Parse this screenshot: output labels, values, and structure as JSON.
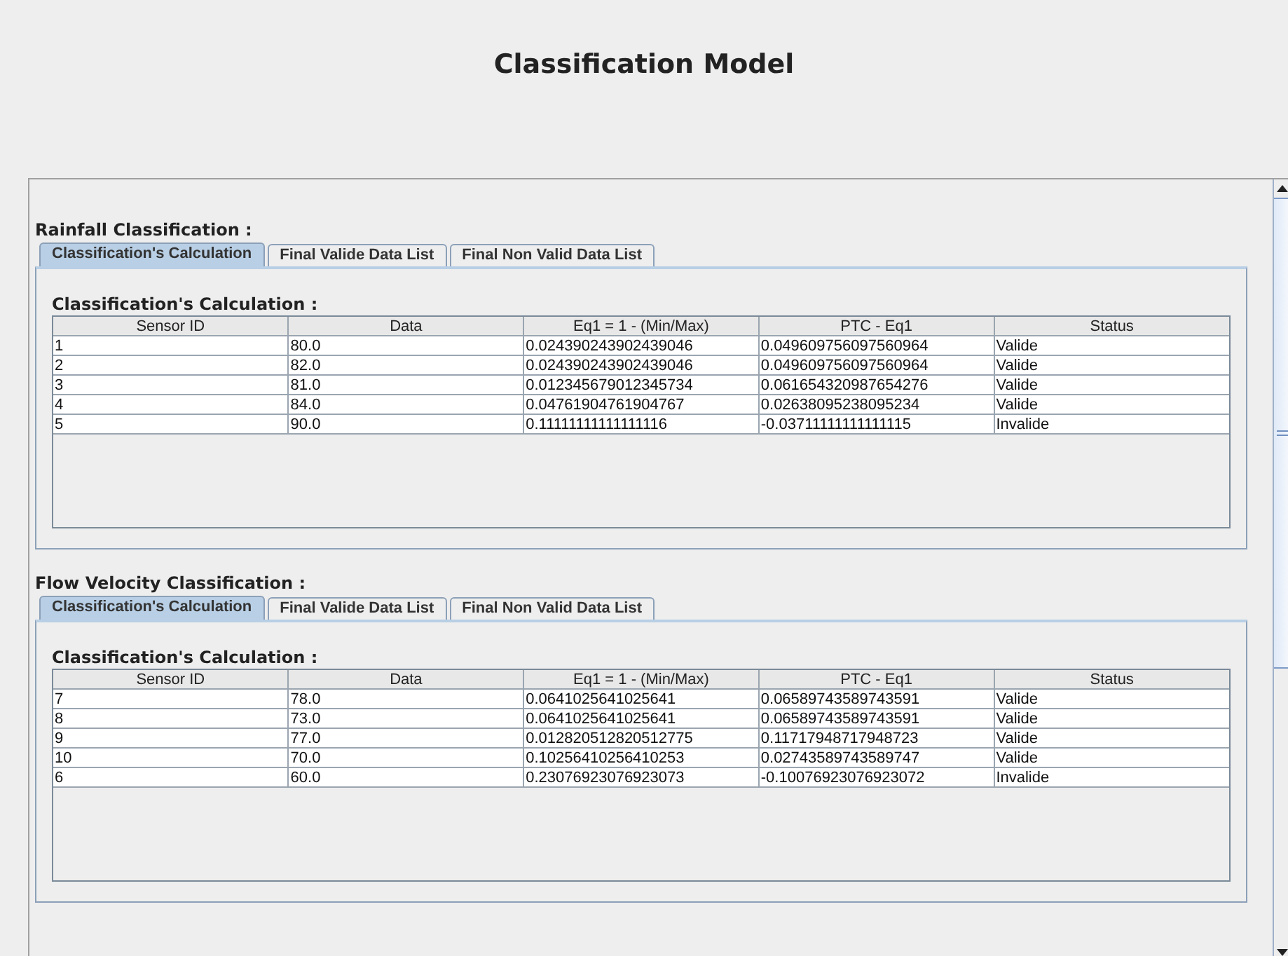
{
  "title": "Classification Model",
  "sections": [
    {
      "title": "Rainfall Classification :",
      "tabs": [
        {
          "label": "Classification's Calculation",
          "selected": true
        },
        {
          "label": "Final Valide Data List",
          "selected": false
        },
        {
          "label": "Final Non Valid Data List",
          "selected": false
        }
      ],
      "panel_title": "Classification's Calculation :",
      "columns": [
        "Sensor ID",
        "Data",
        "Eq1 = 1 - (Min/Max)",
        "PTC - Eq1",
        "Status"
      ],
      "rows": [
        [
          "1",
          "80.0",
          "0.024390243902439046",
          "0.049609756097560964",
          "Valide"
        ],
        [
          "2",
          "82.0",
          "0.024390243902439046",
          "0.049609756097560964",
          "Valide"
        ],
        [
          "3",
          "81.0",
          "0.012345679012345734",
          "0.061654320987654276",
          "Valide"
        ],
        [
          "4",
          "84.0",
          "0.04761904761904767",
          "0.02638095238095234",
          "Valide"
        ],
        [
          "5",
          "90.0",
          "0.11111111111111116",
          "-0.03711111111111115",
          "Invalide"
        ]
      ]
    },
    {
      "title": "Flow Velocity Classification :",
      "tabs": [
        {
          "label": "Classification's Calculation",
          "selected": true
        },
        {
          "label": "Final Valide Data List",
          "selected": false
        },
        {
          "label": "Final Non Valid Data List",
          "selected": false
        }
      ],
      "panel_title": "Classification's Calculation :",
      "columns": [
        "Sensor ID",
        "Data",
        "Eq1 = 1 - (Min/Max)",
        "PTC - Eq1",
        "Status"
      ],
      "rows": [
        [
          "7",
          "78.0",
          "0.0641025641025641",
          "0.06589743589743591",
          "Valide"
        ],
        [
          "8",
          "73.0",
          "0.0641025641025641",
          "0.06589743589743591",
          "Valide"
        ],
        [
          "9",
          "77.0",
          "0.012820512820512775",
          "0.11717948717948723",
          "Valide"
        ],
        [
          "10",
          "70.0",
          "0.10256410256410253",
          "0.02743589743589747",
          "Valide"
        ],
        [
          "6",
          "60.0",
          "0.23076923076923073",
          "-0.10076923076923072",
          "Invalide"
        ]
      ]
    }
  ]
}
